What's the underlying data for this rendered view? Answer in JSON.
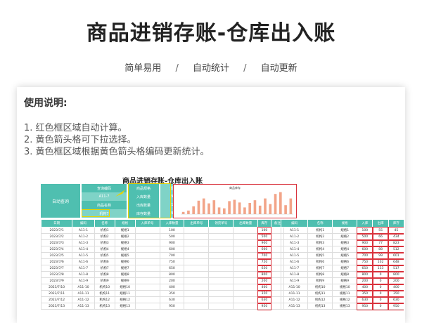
{
  "header": {
    "title": "商品进销存账-仓库出入账",
    "tags": [
      "简单易用",
      "自动统计",
      "自动更新"
    ],
    "separator": "/"
  },
  "instructions": {
    "heading": "使用说明:",
    "items": [
      "1. 红色框区域自动计算。",
      "2. 黄色箭头格可下拉选择。",
      "3. 黄色框区域根据黄色箭头格编码更新统计。"
    ]
  },
  "sheet": {
    "title": "商品进销存账-仓库出入账",
    "query": {
      "label": "自动查询",
      "rows": [
        [
          "查询编码",
          "商品规格",
          "规格7"
        ],
        [
          "A11-7",
          "入库数量",
          "900"
        ],
        [
          "商品名称",
          "出库数量",
          "133"
        ],
        [
          "机构7",
          "库存数量",
          "957"
        ]
      ]
    },
    "chart_title": "商品库存",
    "chart_values": [
      100,
      160,
      350,
      600,
      700,
      480,
      620,
      300,
      260,
      580,
      640,
      520,
      300,
      500,
      620,
      380,
      700,
      450,
      900,
      980,
      400,
      700
    ],
    "main_headers": [
      "日期",
      "编码",
      "名称",
      "规格",
      "入库单号",
      "入库数量",
      "出库单号",
      "领货单号",
      "出库数量",
      "库存",
      "备注"
    ],
    "main_rows": [
      [
        "2023/7/1",
        "A11-1",
        "机构1",
        "规格1",
        "",
        "100",
        "",
        "",
        "",
        "100",
        ""
      ],
      [
        "2023/7/2",
        "A11-2",
        "机构2",
        "规格2",
        "",
        "500",
        "",
        "",
        "",
        "500",
        ""
      ],
      [
        "2023/7/3",
        "A11-3",
        "机构3",
        "规格3",
        "",
        "900",
        "",
        "",
        "",
        "900",
        ""
      ],
      [
        "2023/7/4",
        "A11-4",
        "机构4",
        "规格4",
        "",
        "600",
        "",
        "",
        "",
        "600",
        ""
      ],
      [
        "2023/7/5",
        "A11-5",
        "机构5",
        "规格5",
        "",
        "700",
        "",
        "",
        "",
        "700",
        ""
      ],
      [
        "2023/7/6",
        "A11-6",
        "机构6",
        "规格6",
        "",
        "750",
        "",
        "",
        "",
        "750",
        ""
      ],
      [
        "2023/7/7",
        "A11-7",
        "机构7",
        "规格7",
        "",
        "650",
        "",
        "",
        "",
        "650",
        ""
      ],
      [
        "2023/7/8",
        "A11-8",
        "机构8",
        "规格8",
        "",
        "800",
        "",
        "",
        "",
        "800",
        ""
      ],
      [
        "2023/7/9",
        "A11-9",
        "机构9",
        "规格9",
        "",
        "200",
        "",
        "",
        "",
        "200",
        ""
      ],
      [
        "2023/7/10",
        "A11-10",
        "机构10",
        "规格10",
        "",
        "400",
        "",
        "",
        "",
        "400",
        ""
      ],
      [
        "2023/7/11",
        "A11-11",
        "机构11",
        "规格11",
        "",
        "350",
        "",
        "",
        "",
        "350",
        ""
      ],
      [
        "2023/7/12",
        "A11-12",
        "机构12",
        "规格12",
        "",
        "630",
        "",
        "",
        "",
        "630",
        ""
      ],
      [
        "2023/7/13",
        "A11-13",
        "机构13",
        "规格13",
        "",
        "950",
        "",
        "",
        "",
        "950",
        ""
      ]
    ],
    "side_headers": [
      "编码",
      "名称",
      "规格",
      "入库",
      "出库",
      "库存"
    ],
    "side_rows": [
      [
        "A11-1",
        "机构1",
        "规格1",
        "100",
        "55",
        "45"
      ],
      [
        "A11-2",
        "机构2",
        "规格2",
        "500",
        "66",
        "434"
      ],
      [
        "A11-3",
        "机构3",
        "规格3",
        "900",
        "77",
        "823"
      ],
      [
        "A11-4",
        "机构4",
        "规格4",
        "600",
        "88",
        "512"
      ],
      [
        "A11-5",
        "机构5",
        "规格5",
        "700",
        "99",
        "601"
      ],
      [
        "A11-6",
        "机构6",
        "规格6",
        "750",
        "102",
        "648"
      ],
      [
        "A11-7",
        "机构7",
        "规格7",
        "650",
        "133",
        "517"
      ],
      [
        "A11-8",
        "机构8",
        "规格8",
        "800",
        "0",
        "800"
      ],
      [
        "A11-9",
        "机构9",
        "规格9",
        "200",
        "0",
        "200"
      ],
      [
        "A11-10",
        "机构10",
        "规格10",
        "400",
        "0",
        "400"
      ],
      [
        "A11-11",
        "机构11",
        "规格11",
        "350",
        "0",
        "350"
      ],
      [
        "A11-12",
        "机构12",
        "规格12",
        "630",
        "0",
        "630"
      ],
      [
        "A11-13",
        "机构13",
        "规格13",
        "950",
        "0",
        "950"
      ]
    ]
  }
}
